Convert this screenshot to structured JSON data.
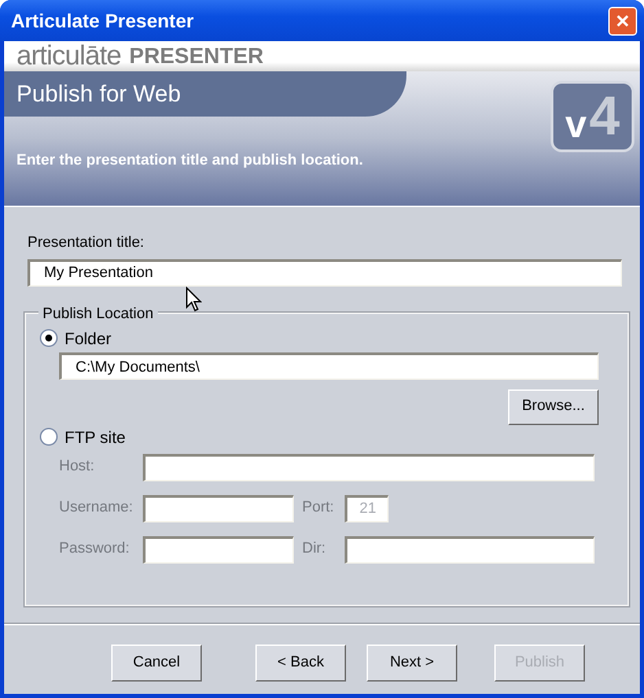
{
  "window": {
    "title": "Articulate Presenter",
    "close_symbol": "✕"
  },
  "brand": {
    "name": "articulāte",
    "product": "PRESENTER"
  },
  "header": {
    "title": "Publish for Web",
    "subtitle": "Enter the presentation title and publish location.",
    "badge_number": "4",
    "badge_letter": "v"
  },
  "title_field": {
    "label": "Presentation title:",
    "value": "My Presentation"
  },
  "publish_location": {
    "legend": "Publish Location",
    "options": [
      {
        "label": "Folder",
        "selected": true
      },
      {
        "label": "FTP site",
        "selected": false
      }
    ],
    "folder_path": "C:\\My Documents\\",
    "browse": "Browse...",
    "ftp_fields": [
      {
        "label": "Host:",
        "disabled": true
      },
      {
        "label": "Username:",
        "disabled": true
      },
      {
        "label": "Port:",
        "value": "21",
        "disabled": true
      },
      {
        "label": "Password:",
        "disabled": true
      },
      {
        "label": "Dir:",
        "disabled": true
      }
    ]
  },
  "buttons": [
    {
      "label": "Cancel",
      "disabled": false
    },
    {
      "label": "< Back",
      "disabled": false
    },
    {
      "label": "Next >",
      "disabled": false
    },
    {
      "label": "Publish",
      "disabled": true
    }
  ]
}
